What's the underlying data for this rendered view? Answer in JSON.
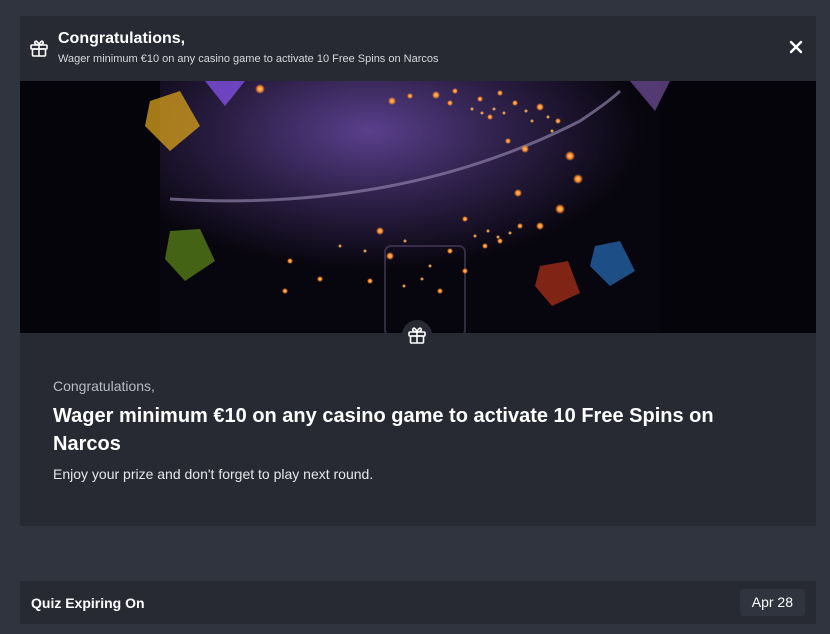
{
  "header": {
    "title": "Congratulations,",
    "subtitle": "Wager minimum €10 on any casino game to activate 10 Free Spins on Narcos",
    "gift_icon": "gift-icon",
    "close_icon": "close-icon"
  },
  "content": {
    "kicker": "Congratulations,",
    "title": "Wager minimum €10 on any casino game to activate 10 Free Spins on Narcos",
    "body": "Enjoy your prize and don't forget to play next round."
  },
  "quiz": {
    "label": "Quiz Expiring On",
    "date": "Apr 28"
  },
  "colors": {
    "background": "#30343e",
    "panel": "#272a33",
    "accent_orange": "#ff9a3a",
    "accent_purple": "#5b3d8f"
  }
}
